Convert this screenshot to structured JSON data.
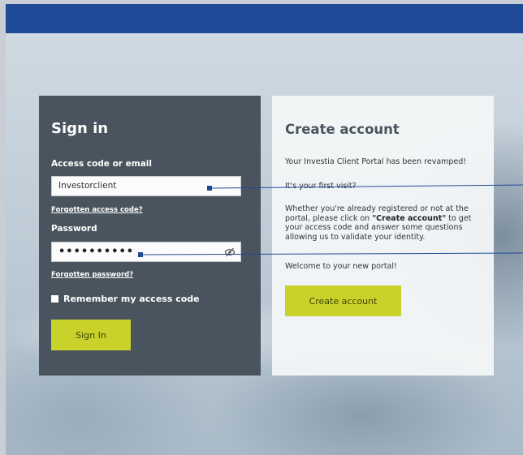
{
  "signin": {
    "title": "Sign in",
    "access_label": "Access code or email",
    "access_value": "Investorclient",
    "forgot_access": "Forgotten access code?",
    "password_label": "Password",
    "password_value": "••••••••••",
    "forgot_password": "Forgotten password?",
    "remember_label": "Remember my access code",
    "button": "Sign In"
  },
  "create": {
    "title": "Create account",
    "line1": "Your Investia Client Portal has been revamped!",
    "line2": "It's your first visit?",
    "para_before": "Whether you're already registered or not at the portal, please click on ",
    "para_bold": "\"Create account\"",
    "para_after": " to get your access code and answer some questions allowing us to validate your identity.",
    "welcome": "Welcome to your new portal!",
    "button": "Create account"
  },
  "colors": {
    "topbar": "#1f4a97",
    "panel_dark": "#4a545e",
    "accent": "#c9d22a",
    "annotation": "#1f4a97"
  },
  "icons": [
    "eye-slash-icon",
    "checkbox-icon"
  ]
}
